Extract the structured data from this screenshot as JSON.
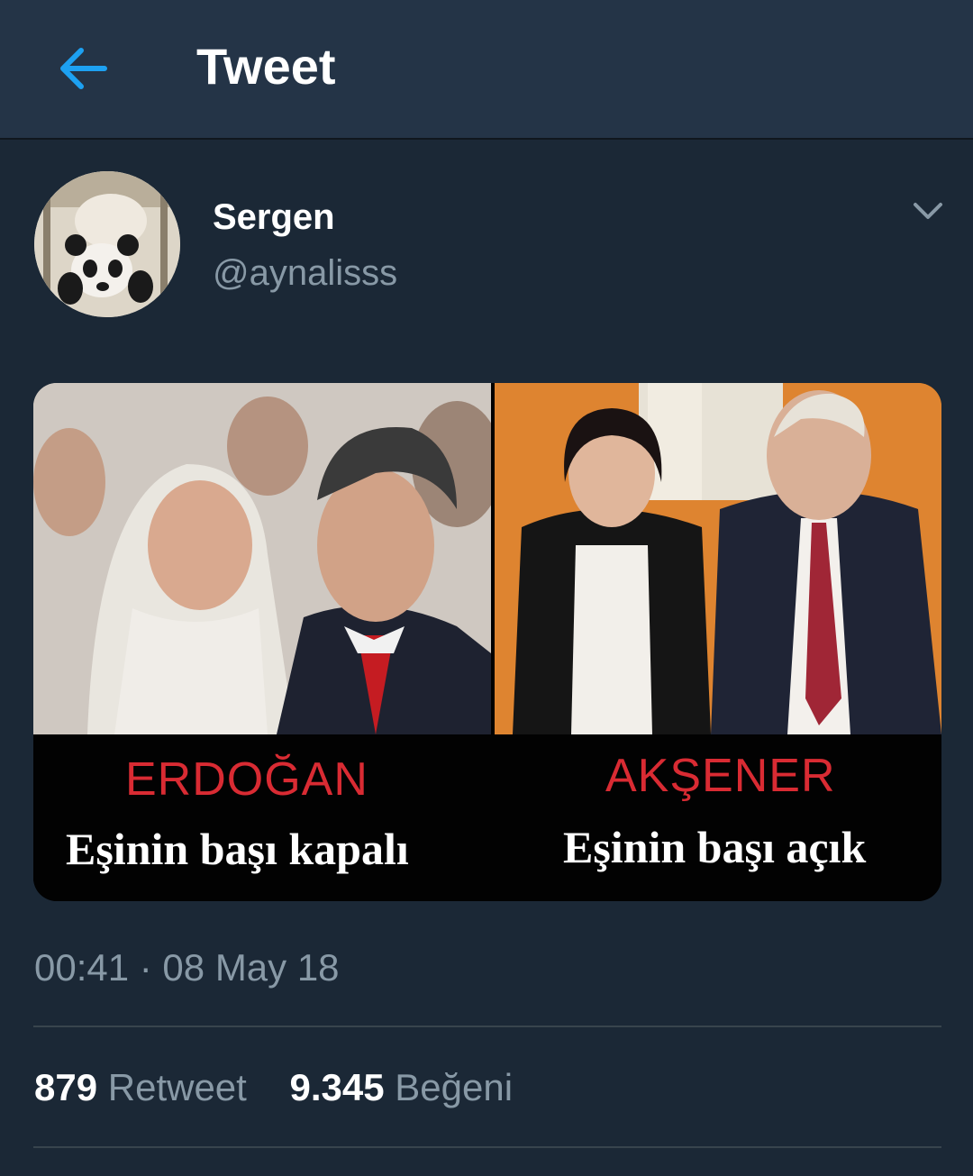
{
  "header": {
    "title": "Tweet",
    "back_icon": "arrow-left-icon",
    "accent_color": "#1da1f2"
  },
  "tweet": {
    "author": {
      "name": "Sergen",
      "handle": "@aynalisss"
    },
    "media": {
      "left": {
        "name": "ERDOĞAN",
        "caption": "Eşinin başı kapalı"
      },
      "right": {
        "name": "AKŞENER",
        "caption": "Eşinin başı açık"
      }
    },
    "timestamp": "00:41 · 08 May 18",
    "stats": {
      "retweets_count": "879",
      "retweets_label": "Retweet",
      "likes_count": "9.345",
      "likes_label": "Beğeni"
    }
  },
  "colors": {
    "background": "#1b2836",
    "header_bg": "#243447",
    "secondary_text": "#8899a6",
    "caption_red": "#d92b33"
  }
}
